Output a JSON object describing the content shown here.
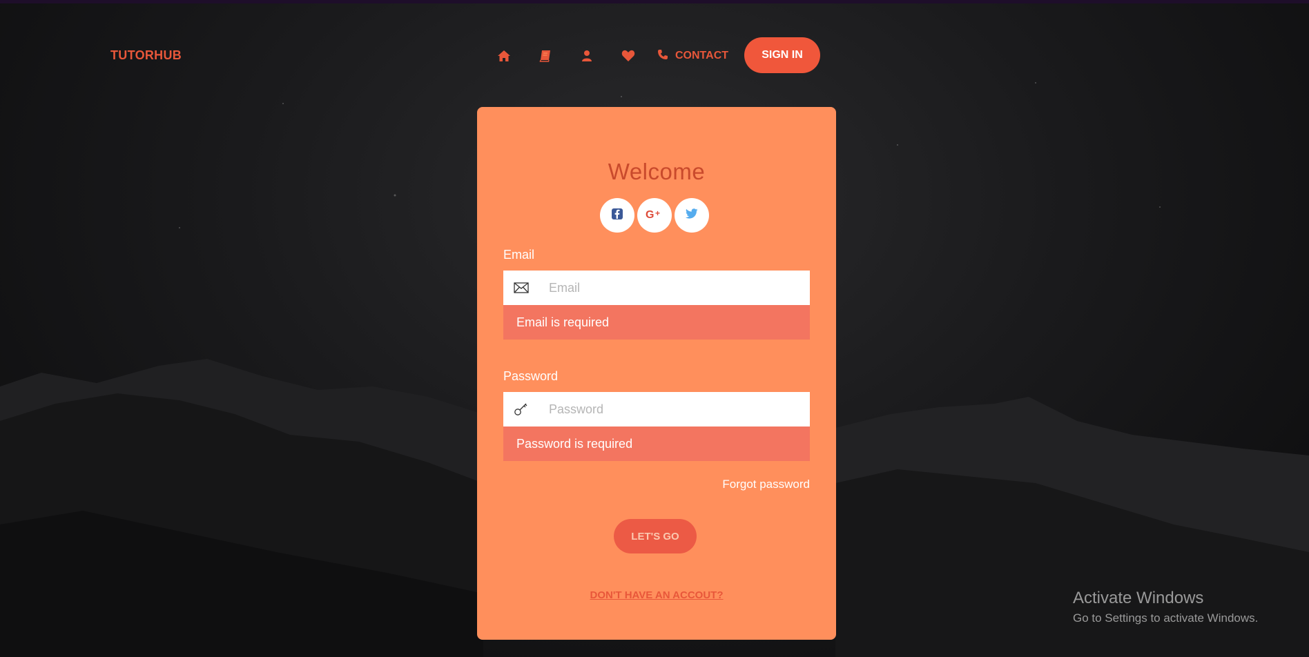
{
  "brand": "TUTORHUB",
  "nav": {
    "icons": [
      "home-icon",
      "book-icon",
      "user-icon",
      "heart-icon"
    ],
    "contact_label": "CONTACT",
    "signin_label": "SIGN IN"
  },
  "login": {
    "title": "Welcome",
    "socials": [
      "facebook-icon",
      "google-plus-icon",
      "twitter-icon"
    ],
    "email": {
      "label": "Email",
      "placeholder": "Email",
      "value": "",
      "error": "Email is required"
    },
    "password": {
      "label": "Password",
      "placeholder": "Password",
      "value": "",
      "error": "Password is required"
    },
    "forgot_label": "Forgot password",
    "submit_label": "LET'S GO",
    "signup_label": "DON'T HAVE AN ACCOUT?"
  },
  "windows_watermark": {
    "title": "Activate Windows",
    "subtitle": "Go to Settings to activate Windows."
  },
  "colors": {
    "accent": "#f0573b",
    "card": "#ff8f5c",
    "error_bg": "#f37560"
  }
}
